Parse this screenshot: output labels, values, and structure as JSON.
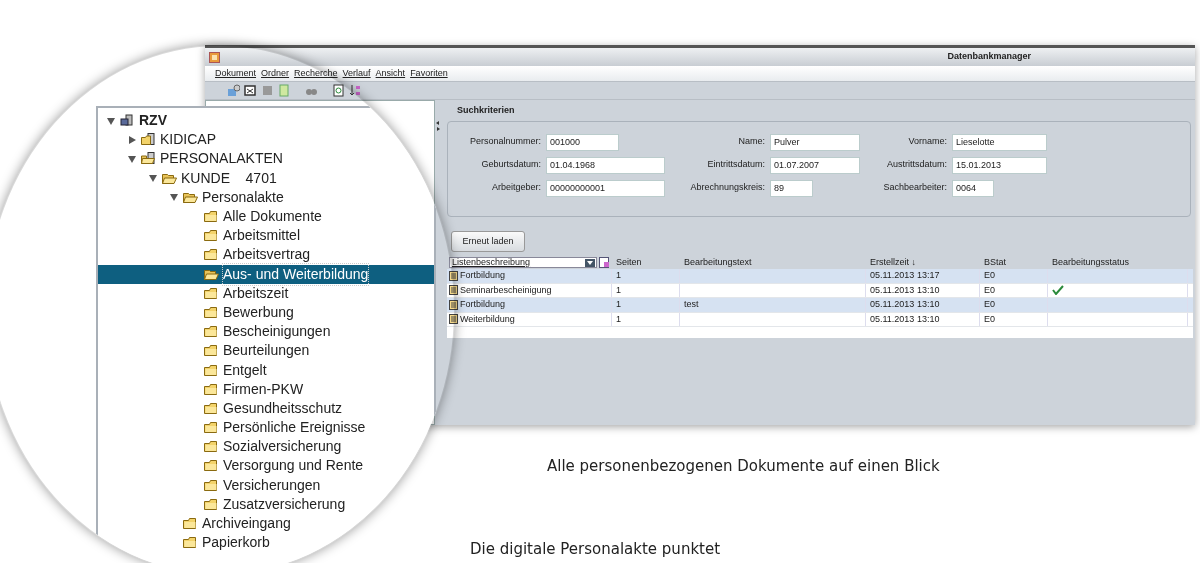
{
  "window": {
    "title": "Datenbankmanager"
  },
  "menu": [
    "Dokument",
    "Ordner",
    "Recherche",
    "Verlauf",
    "Ansicht",
    "Favoriten"
  ],
  "tree": [
    {
      "label": "RZV",
      "kind": "server",
      "expanded": true,
      "selected": false,
      "children": [
        {
          "label": "KIDICAP",
          "kind": "server-folder",
          "expanded": false,
          "selected": false
        },
        {
          "label": "PERSONALAKTEN",
          "kind": "server-folder-open",
          "expanded": true,
          "selected": false,
          "children": [
            {
              "label": "KUNDE    4701",
              "kind": "folder-open",
              "expanded": true,
              "selected": false,
              "children": [
                {
                  "label": "Personalakte",
                  "kind": "folder-open",
                  "expanded": true,
                  "selected": false,
                  "children": [
                    {
                      "label": "Alle Dokumente",
                      "kind": "folder",
                      "selected": false
                    },
                    {
                      "label": "Arbeitsmittel",
                      "kind": "folder",
                      "selected": false
                    },
                    {
                      "label": "Arbeitsvertrag",
                      "kind": "folder",
                      "selected": false
                    },
                    {
                      "label": "Aus- und Weiterbildung",
                      "kind": "folder-open",
                      "selected": true
                    },
                    {
                      "label": "Arbeitszeit",
                      "kind": "folder",
                      "selected": false
                    },
                    {
                      "label": "Bewerbung",
                      "kind": "folder",
                      "selected": false
                    },
                    {
                      "label": "Bescheinigungen",
                      "kind": "folder",
                      "selected": false
                    },
                    {
                      "label": "Beurteilungen",
                      "kind": "folder",
                      "selected": false
                    },
                    {
                      "label": "Entgelt",
                      "kind": "folder",
                      "selected": false
                    },
                    {
                      "label": "Firmen-PKW",
                      "kind": "folder",
                      "selected": false
                    },
                    {
                      "label": "Gesundheitsschutz",
                      "kind": "folder",
                      "selected": false
                    },
                    {
                      "label": "Persönliche Ereignisse",
                      "kind": "folder",
                      "selected": false
                    },
                    {
                      "label": "Sozialversicherung",
                      "kind": "folder",
                      "selected": false
                    },
                    {
                      "label": "Versorgung und Rente",
                      "kind": "folder",
                      "selected": false
                    },
                    {
                      "label": "Versicherungen",
                      "kind": "folder",
                      "selected": false
                    },
                    {
                      "label": "Zusatzversicherung",
                      "kind": "folder",
                      "selected": false
                    }
                  ]
                },
                {
                  "label": "Archiveingang",
                  "kind": "folder",
                  "selected": false
                },
                {
                  "label": "Papierkorb",
                  "kind": "folder",
                  "selected": false
                }
              ]
            }
          ]
        }
      ]
    }
  ],
  "search": {
    "title": "Suchkriterien",
    "fields": [
      {
        "label": "Personalnummer:",
        "value": "001000"
      },
      {
        "label": "Name:",
        "value": "Pulver"
      },
      {
        "label": "Vorname:",
        "value": "Lieselotte"
      },
      {
        "label": "Geburtsdatum:",
        "value": "01.04.1968"
      },
      {
        "label": "Eintrittsdatum:",
        "value": "01.07.2007"
      },
      {
        "label": "Austrittsdatum:",
        "value": "15.01.2013"
      },
      {
        "label": "Arbeitgeber:",
        "value": "00000000001"
      },
      {
        "label": "Abrechnungskreis:",
        "value": "89"
      },
      {
        "label": "Sachbearbeiter:",
        "value": "0064"
      }
    ]
  },
  "reload_button": "Erneut laden",
  "table": {
    "column_selector": "Listenbeschreibung",
    "columns": [
      "Seiten",
      "Bearbeitungstext",
      "Erstellzeit ↓",
      "BStat",
      "Bearbeitungsstatus"
    ],
    "rows": [
      {
        "name": "Fortbildung",
        "pages": "1",
        "created": "05.11.2013 13:17",
        "bstat": "E0",
        "done": false
      },
      {
        "name": "Seminarbescheinigung",
        "pages": "1",
        "created": "05.11.2013 13:10",
        "bstat": "E0",
        "done": true
      },
      {
        "name": "Fortbildung",
        "pages": "1",
        "text": "test",
        "created": "05.11.2013 13:10",
        "bstat": "E0",
        "done": false
      },
      {
        "name": "Weiterbildung",
        "pages": "1",
        "created": "05.11.2013 13:10",
        "bstat": "E0",
        "done": false
      }
    ]
  },
  "captions": [
    "Alle personenbezogenen Dokumente auf einen Blick",
    "Die digitale Personalakte punktet"
  ]
}
